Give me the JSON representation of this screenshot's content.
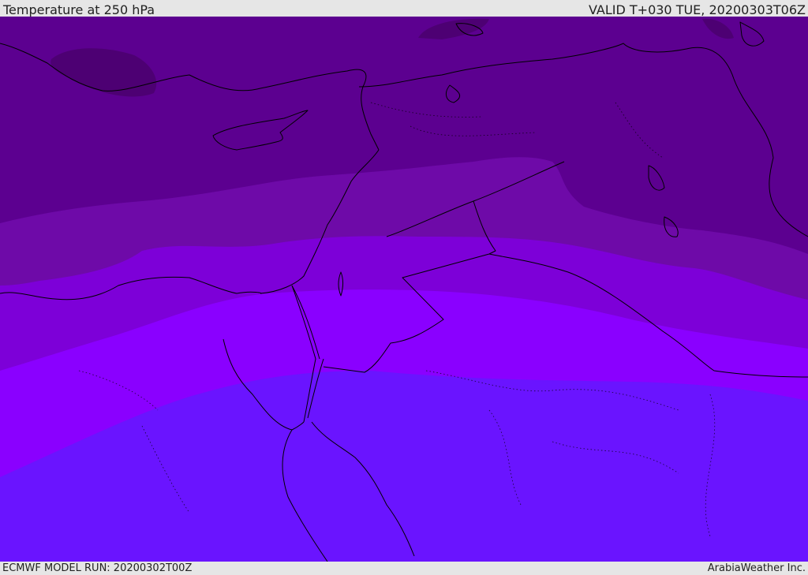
{
  "header": {
    "title": "Temperature at 250 hPa",
    "valid_time": "VALID T+030 TUE, 20200303T06Z"
  },
  "footer": {
    "model_run": "ECMWF MODEL RUN: 20200302T00Z",
    "brand": "ArabiaWeather Inc."
  },
  "map": {
    "variable": "Temperature",
    "pressure_level_hpa": 250,
    "colors": {
      "band_coldest": "#4d0073",
      "band_1": "#5c0090",
      "band_2": "#6e0aa8",
      "band_3": "#7d00d8",
      "band_4": "#8a00ff",
      "band_warmest": "#6a14ff",
      "coastline": "#000000"
    }
  }
}
